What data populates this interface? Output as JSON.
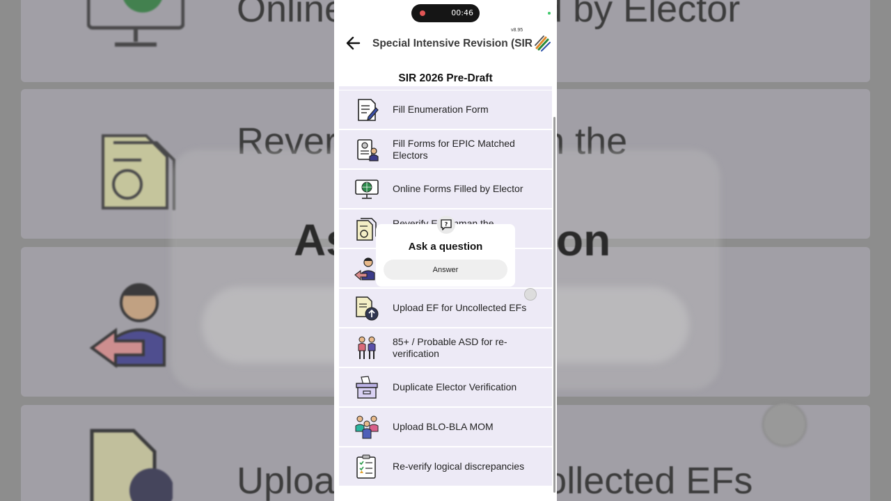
{
  "background": {
    "row1_text": "Online Forms Filled by Elector",
    "row2_text": "Reverify EF/Unman the",
    "dialog_text": "Ask a question",
    "row4_text": "Upload EF for Uncollected EFs"
  },
  "status": {
    "recording_time": "00:46"
  },
  "appbar": {
    "title": "Special Intensive Revision (SIR",
    "version": "v8.95",
    "back_icon": "arrow-left-icon",
    "logo_icon": "eci-logo-icon"
  },
  "section": {
    "title": "SIR 2026 Pre-Draft"
  },
  "menu": [
    {
      "label": "Fill Enumeration Form",
      "icon": "form-edit-icon"
    },
    {
      "label": "Fill Forms for EPIC Matched Electors",
      "icon": "id-card-icon"
    },
    {
      "label": "Online Forms Filled by Elector",
      "icon": "monitor-globe-icon"
    },
    {
      "label": "Reverify EF/Unman the",
      "icon": "document-refresh-icon"
    },
    {
      "label": "",
      "icon": "person-return-icon"
    },
    {
      "label": "Upload EF for Uncollected EFs",
      "icon": "document-upload-icon"
    },
    {
      "label": "85+ / Probable ASD for re-verification",
      "icon": "elderly-couple-icon"
    },
    {
      "label": "Duplicate Elector Verification",
      "icon": "ballot-box-icon"
    },
    {
      "label": "Upload BLO-BLA MOM",
      "icon": "meeting-people-icon"
    },
    {
      "label": "Re-verify logical discrepancies",
      "icon": "checklist-icon"
    }
  ],
  "popup": {
    "title": "Ask a question",
    "button": "Answer",
    "icon": "question-bubble-icon"
  },
  "colors": {
    "item_bg": "#edeaf6",
    "accent": "#3a3a3a"
  }
}
